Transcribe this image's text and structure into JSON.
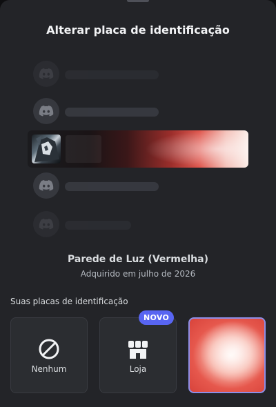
{
  "header": {
    "title": "Alterar placa de identificação"
  },
  "preview": {
    "rows": [
      {
        "icon": "discord-logo-icon"
      },
      {
        "icon": "discord-logo-icon"
      },
      {
        "icon": "profile-avatar"
      },
      {
        "icon": "discord-logo-icon"
      },
      {
        "icon": "discord-logo-icon"
      }
    ]
  },
  "selected_plate": {
    "name": "Parede de Luz (Vermelha)",
    "acquired": "Adquirido em julho de 2026"
  },
  "plates_section": {
    "label": "Suas placas de identificação",
    "tiles": [
      {
        "label": "Nenhum",
        "icon": "no-symbol-icon"
      },
      {
        "label": "Loja",
        "icon": "shop-icon",
        "badge": "NOVO"
      },
      {
        "label": "",
        "icon": "plate-thumbnail",
        "selected": true
      }
    ]
  },
  "colors": {
    "accent": "#5865f2",
    "selected_border": "#8c8ee8",
    "plate_red": "#e0584f"
  }
}
